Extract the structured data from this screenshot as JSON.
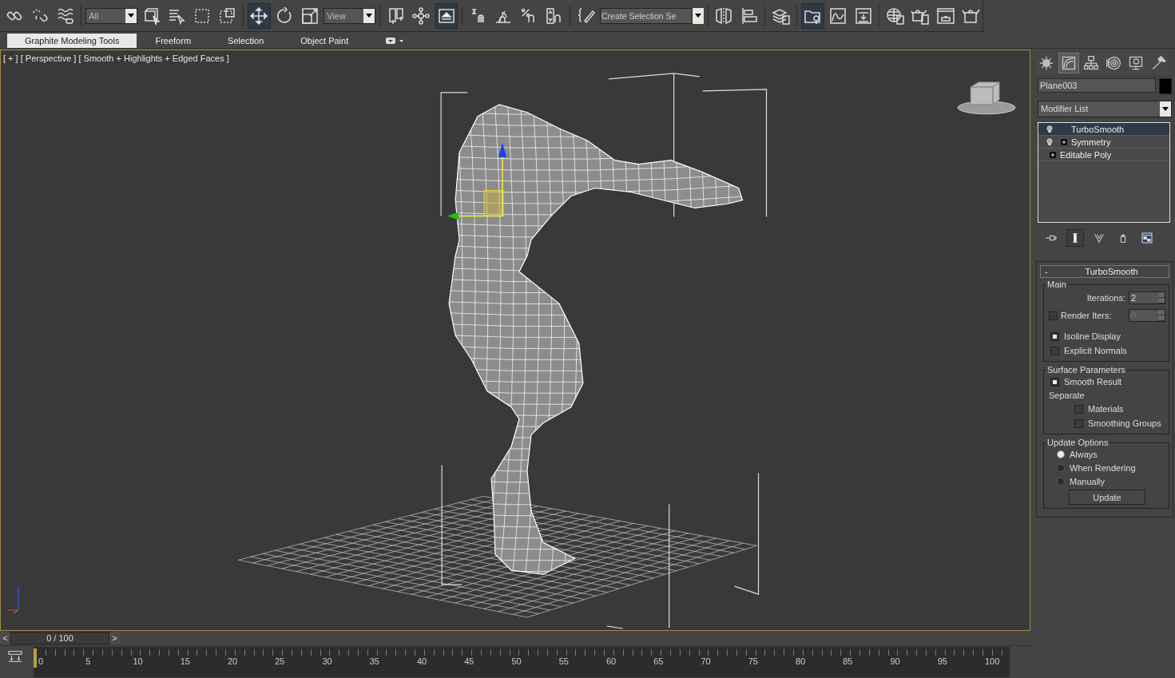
{
  "toolbar": {
    "items": [
      {
        "kind": "button",
        "selected": false
      },
      {
        "kind": "button",
        "selected": false
      },
      {
        "kind": "button",
        "selected": false
      },
      {
        "kind": "dropdown",
        "value": "All"
      },
      {
        "kind": "button",
        "selected": false
      },
      {
        "kind": "button",
        "selected": false
      },
      {
        "kind": "button",
        "selected": false
      },
      {
        "kind": "button",
        "selected": false
      },
      {
        "kind": "button",
        "selected": true
      },
      {
        "kind": "button",
        "selected": false
      },
      {
        "kind": "button",
        "selected": false
      },
      {
        "kind": "dropdown",
        "value": "View"
      },
      {
        "kind": "button",
        "selected": false
      },
      {
        "kind": "button",
        "selected": false
      },
      {
        "kind": "button",
        "selected": true
      },
      {
        "kind": "button",
        "selected": false
      },
      {
        "kind": "button",
        "selected": false
      },
      {
        "kind": "button",
        "selected": false
      },
      {
        "kind": "button",
        "selected": false
      },
      {
        "kind": "button",
        "selected": false
      },
      {
        "kind": "field",
        "placeholder": "Create Selection Se"
      },
      {
        "kind": "button",
        "selected": false
      },
      {
        "kind": "button",
        "selected": false
      },
      {
        "kind": "button",
        "selected": false
      },
      {
        "kind": "button",
        "selected": true
      },
      {
        "kind": "button",
        "selected": false
      },
      {
        "kind": "button",
        "selected": false
      },
      {
        "kind": "button",
        "selected": false
      },
      {
        "kind": "button",
        "selected": false
      },
      {
        "kind": "button",
        "selected": false
      },
      {
        "kind": "button",
        "selected": false
      }
    ]
  },
  "ribbon_tabs": [
    {
      "label": "Graphite Modeling Tools",
      "selected": true
    },
    {
      "label": "Freeform",
      "selected": false
    },
    {
      "label": "Selection",
      "selected": false
    },
    {
      "label": "Object Paint",
      "selected": false
    }
  ],
  "viewport": {
    "label": "[ + ] [ Perspective ] [ Smooth + Highlights + Edged Faces ]"
  },
  "command_panel": {
    "tabs": [
      {
        "selected": false
      },
      {
        "selected": true
      },
      {
        "selected": false
      },
      {
        "selected": false
      },
      {
        "selected": false
      },
      {
        "selected": false
      }
    ],
    "object_name": "Plane003",
    "modifier_list": "Modifier List",
    "stack": [
      {
        "label": "TurboSmooth",
        "bulb": true,
        "expandable": false,
        "selected": true
      },
      {
        "label": "Symmetry",
        "bulb": true,
        "expandable": true,
        "selected": false
      },
      {
        "label": "Editable Poly",
        "bulb": false,
        "expandable": true,
        "selected": false
      }
    ],
    "rollout": {
      "title": "TurboSmooth",
      "collapse": "-",
      "main": {
        "title": "Main",
        "iterations_label": "Iterations:",
        "iterations": "2",
        "render_iters_label": "Render Iters:",
        "render_iters_checked": false,
        "render_iters": "0",
        "options": [
          {
            "label": "Isoline Display",
            "checked": true
          },
          {
            "label": "Explicit Normals",
            "checked": false
          }
        ]
      },
      "surface": {
        "title": "Surface Parameters",
        "smooth_result": {
          "label": "Smooth Result",
          "checked": true
        },
        "separate_label": "Separate",
        "options": [
          {
            "label": "Materials",
            "checked": false
          },
          {
            "label": "Smoothing Groups",
            "checked": false
          }
        ]
      },
      "update": {
        "title": "Update Options",
        "options": [
          {
            "label": "Always",
            "selected": true
          },
          {
            "label": "When Rendering",
            "selected": false
          },
          {
            "label": "Manually",
            "selected": false
          }
        ],
        "button": "Update"
      }
    }
  },
  "timeline": {
    "level": 0,
    "prev": "<",
    "slider": "0 / 100",
    "next": ">",
    "ticks": [
      "0",
      "5",
      "10",
      "15",
      "20",
      "25",
      "30",
      "35",
      "40",
      "45",
      "50",
      "55",
      "60",
      "65",
      "70",
      "75",
      "80",
      "85",
      "90",
      "95",
      "100"
    ]
  }
}
